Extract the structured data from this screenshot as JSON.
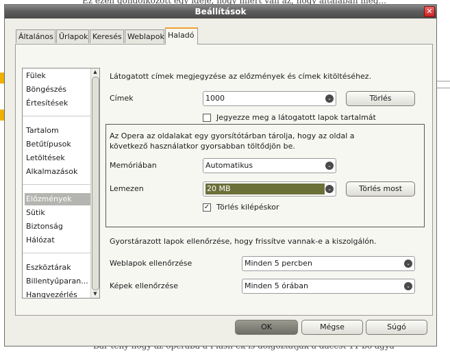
{
  "background": {
    "top_text": "Ez ezen gondolkozott egy ideje, hogy miért van az, hogy általában meg...",
    "bottom_text": "Bár tény hogy az operába a Flash-ek is dolgoztatják a dacest 11 bo agya"
  },
  "dialog": {
    "title": "Beállítások",
    "close_symbol": "✕"
  },
  "tabs": [
    "Általános",
    "Űrlapok",
    "Keresés",
    "Weblapok",
    "Haladó"
  ],
  "active_tab": "Haladó",
  "categories": [
    "Fülek",
    "Böngészés",
    "Értesítések",
    "Tartalom",
    "Betűtípusok",
    "Letöltések",
    "Alkalmazások",
    "Előzmények",
    "Sütik",
    "Biztonság",
    "Hálózat",
    "Eszköztárak",
    "Billentyűparan...",
    "Hangvezérlés"
  ],
  "selected_category": "Előzmények",
  "scroll": {
    "up": "▲",
    "down": "▼"
  },
  "history": {
    "intro": "Látogatott címek megjegyzése az előzmények és címek kitöltéséhez.",
    "addresses_label": "Címek",
    "addresses_value": "1000",
    "clear_button": "Törlés",
    "remember_content_label": "Jegyezze meg a látogatott lapok tartalmát",
    "remember_content_checked": false
  },
  "cache": {
    "intro": "Az Opera az oldalakat egy gyorsítótárban tárolja, hogy az oldal a következő használatkor gyorsabban töltődjön be.",
    "memory_label": "Memóriában",
    "memory_value": "Automatikus",
    "disk_label": "Lemezen",
    "disk_value": "20 MB",
    "clear_now_button": "Törlés most",
    "clear_on_exit_label": "Törlés kilépéskor",
    "clear_on_exit_checked": true
  },
  "freshness": {
    "intro": "Gyorstárazott lapok ellenőrzése, hogy frissítve vannak-e a kiszolgálón.",
    "pages_label": "Weblapok ellenőrzése",
    "pages_value": "Minden 5 percben",
    "images_label": "Képek ellenőrzése",
    "images_value": "Minden 5 órában"
  },
  "footer": {
    "ok": "OK",
    "cancel": "Mégse",
    "help": "Súgó"
  },
  "icons": {
    "dropdown": "⌄",
    "check": "✓"
  }
}
